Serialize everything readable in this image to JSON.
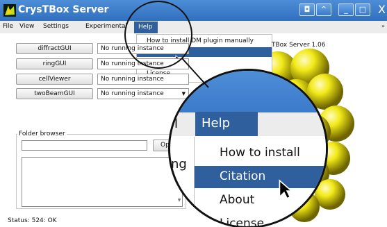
{
  "window": {
    "title": "CrysTBox Server",
    "buttons": {
      "restore": "◘",
      "up": "^",
      "minimize": "_",
      "maximize": "□",
      "close": "X"
    }
  },
  "menubar": {
    "items": [
      "File",
      "View",
      "Settings",
      "Experimental",
      "Help"
    ],
    "overflow": "»"
  },
  "help_menu": {
    "items": [
      "How to install DM plugin manually",
      "Citation",
      "About",
      "License"
    ],
    "selected": "Citation"
  },
  "server_version": "TBox Server 1.06",
  "gui_rows": [
    {
      "button": "diffractGUI",
      "instance": "No running instance"
    },
    {
      "button": "ringGUI",
      "instance": "No running instance"
    },
    {
      "button": "cellViewer",
      "instance": "No running instance"
    },
    {
      "button": "twoBeamGUI",
      "instance": "No running instance"
    }
  ],
  "folder_browser": {
    "title": "Folder browser",
    "path_value": "",
    "open_label": "Open"
  },
  "status": {
    "label": "Status:",
    "code": "524: OK"
  },
  "magnifier": {
    "fragment_left": "l",
    "help_label": "Help",
    "items": [
      "How to install",
      "Citation",
      "About",
      "License"
    ],
    "fragment_ing": "ing"
  },
  "colors": {
    "titlebar": "#3d7ccb",
    "menu_selection": "#2f5f9c",
    "sphere": "#f2ea18"
  },
  "icons": [
    "app-icon",
    "arrow-cursor-icon",
    "combo-arrow-icon"
  ]
}
